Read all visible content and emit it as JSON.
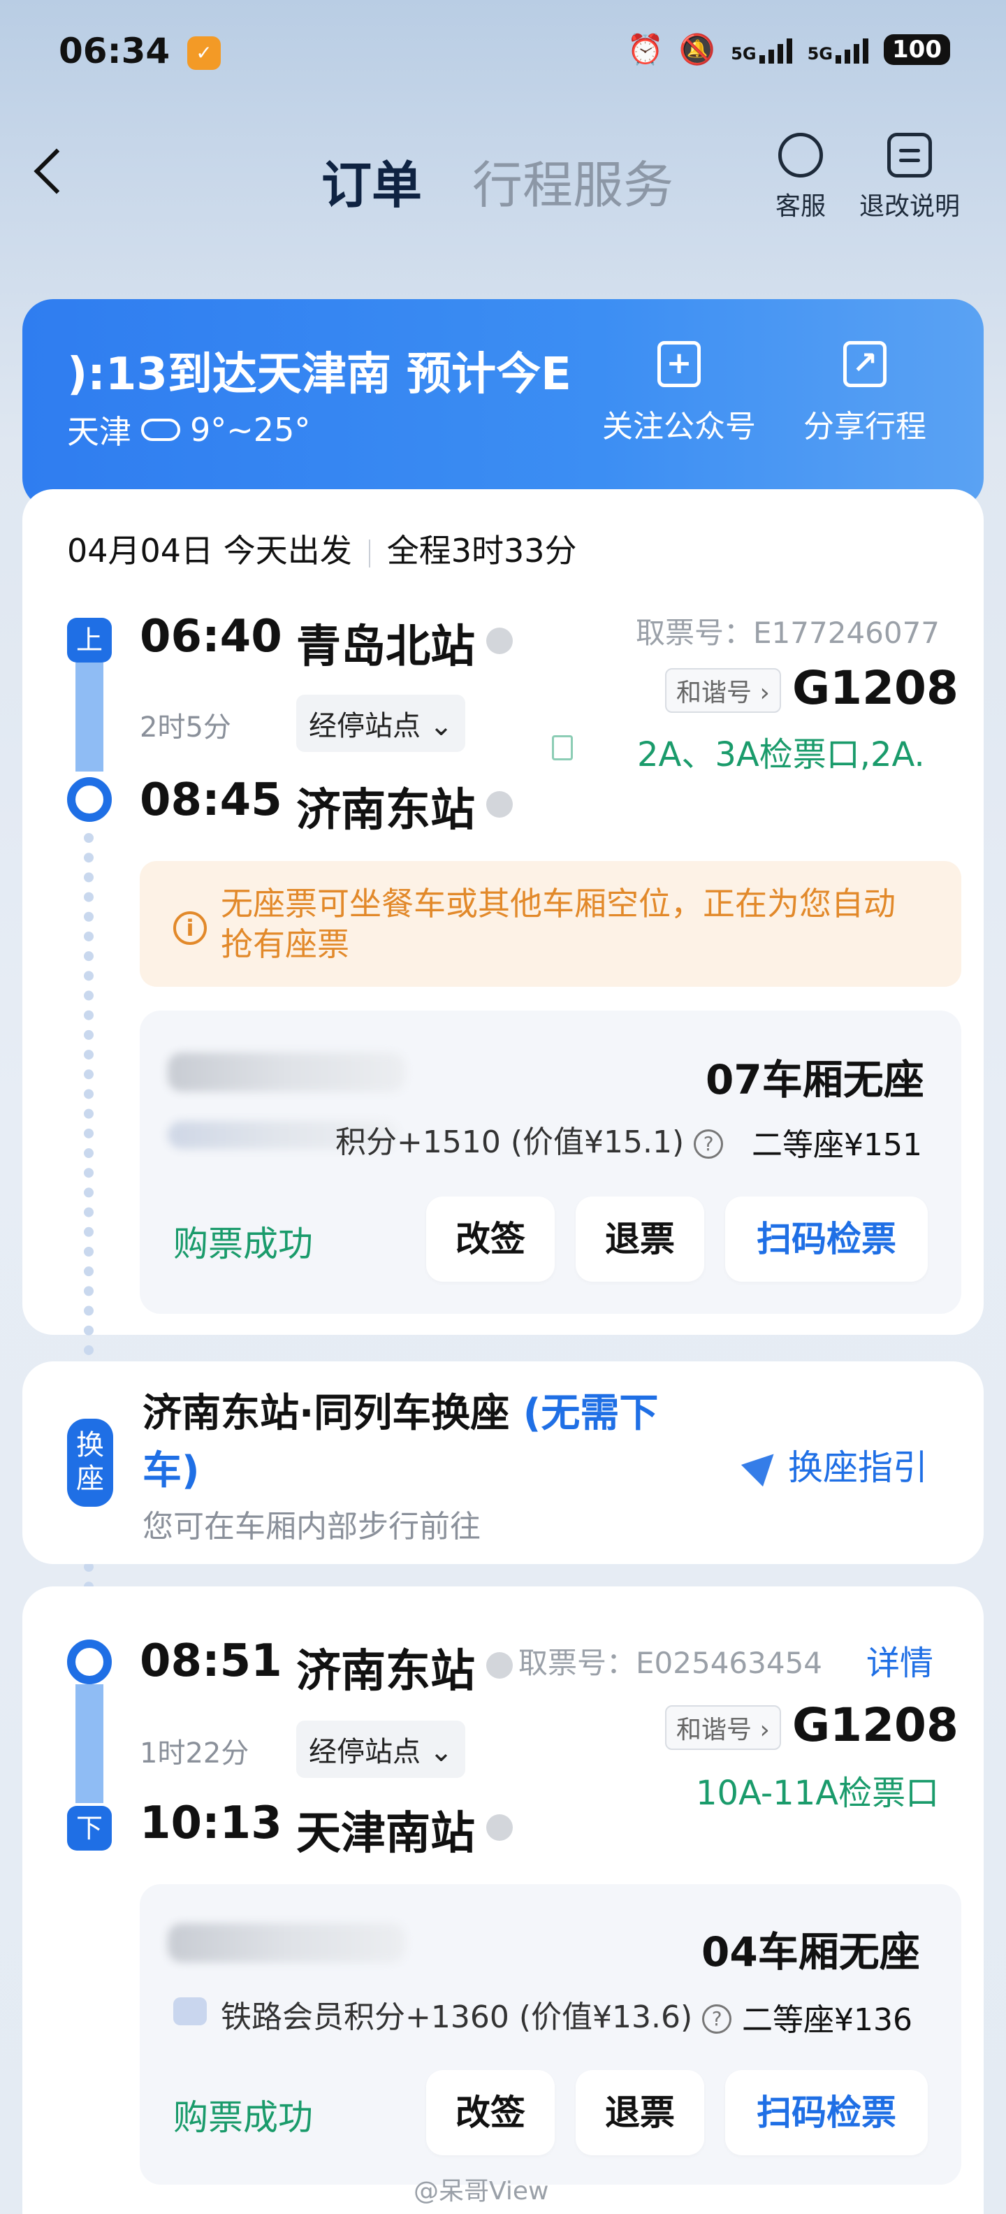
{
  "status_bar": {
    "time": "06:34",
    "net1": "5G",
    "net2": "5G",
    "battery": "100"
  },
  "header": {
    "tab_active": "订单",
    "tab_inactive": "行程服务",
    "support_label": "客服",
    "refund_info_label": "退改说明"
  },
  "banner": {
    "title": "):13到达天津南    预计今E",
    "city": "天津",
    "temp": "9°~25°",
    "follow_label": "关注公众号",
    "share_label": "分享行程"
  },
  "trip": {
    "date": "04月04日 今天出发",
    "total": "全程3时33分"
  },
  "leg1": {
    "badge_start": "上",
    "dep_time": "06:40",
    "dep_station": "青岛北站",
    "duration": "2时5分",
    "stops_label": "经停站点",
    "arr_time": "08:45",
    "arr_station": "济南东站",
    "ticket_no": "取票号：E177246077",
    "train_tag": "和谐号",
    "train_no": "G1208",
    "gate": "2A、3A检票口,2A.",
    "notice": "无座票可坐餐车或其他车厢空位，正在为您自动抢有座票",
    "points": "积分+1510 (价值¥15.1)",
    "car_status": "07车厢无座",
    "seat": "二等座¥151",
    "status": "购票成功",
    "btn_change": "改签",
    "btn_refund": "退票",
    "btn_scan": "扫码检票"
  },
  "transfer": {
    "badge": "换座",
    "title_black": "济南东站·同列车换座",
    "title_blue": "(无需下车)",
    "sub": "您可在车厢内部步行前往",
    "guide": "换座指引"
  },
  "leg2": {
    "badge_end": "下",
    "dep_time": "08:51",
    "dep_station": "济南东站",
    "duration": "1时22分",
    "stops_label": "经停站点",
    "arr_time": "10:13",
    "arr_station": "天津南站",
    "ticket_no": "取票号：E025463454",
    "detail": "详情",
    "train_tag": "和谐号",
    "train_no": "G1208",
    "gate": "10A-11A检票口",
    "points": "铁路会员积分+1360 (价值¥13.6)",
    "car_status": "04车厢无座",
    "seat": "二等座¥136",
    "status": "购票成功",
    "btn_change": "改签",
    "btn_refund": "退票",
    "btn_scan": "扫码检票"
  },
  "watermark": "@呆哥View"
}
